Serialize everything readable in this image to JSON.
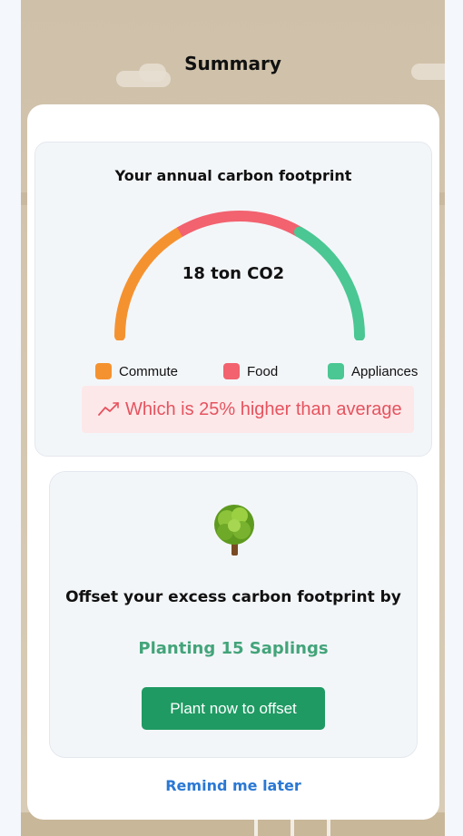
{
  "header": {
    "title": "Summary"
  },
  "footprint": {
    "heading": "Your annual carbon footprint",
    "value_text": "18 ton CO2",
    "segments": [
      {
        "name": "Commute",
        "color": "#f59230",
        "share": 0.3333
      },
      {
        "name": "Food",
        "color": "#f2626f",
        "share": 0.3333
      },
      {
        "name": "Appliances",
        "color": "#4ac793",
        "share": 0.3334
      }
    ],
    "comparison": {
      "icon": "trend-up-icon",
      "text": "Which is 25% higher than average",
      "color": "#e5535f"
    }
  },
  "offset": {
    "icon": "tree-icon",
    "heading": "Offset your excess carbon footprint by",
    "action_text": "Planting 15 Saplings",
    "button_label": "Plant now to offset"
  },
  "remind_label": "Remind me later"
}
